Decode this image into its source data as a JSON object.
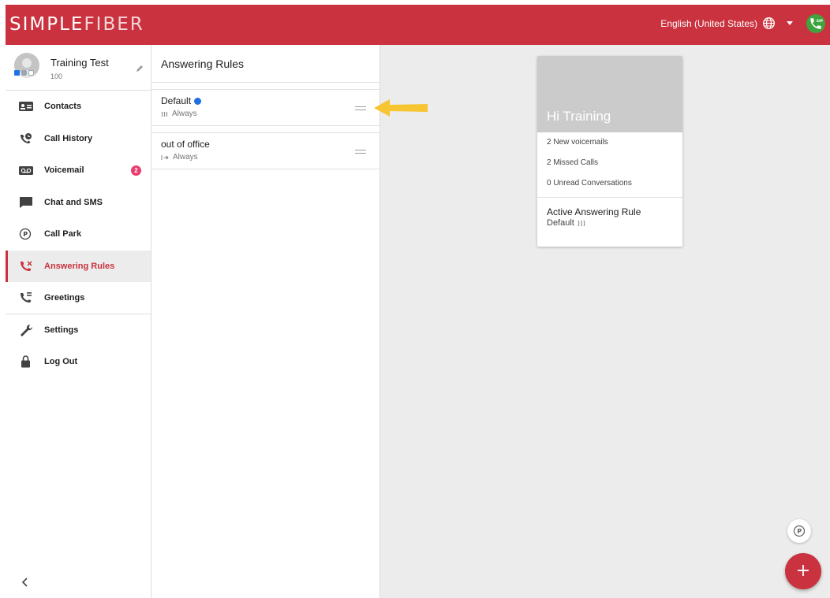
{
  "app": {
    "logo_part1": "SIMPLE",
    "logo_part2": "FIBER",
    "brand_color": "#c9323e"
  },
  "header": {
    "language": "English (United States)",
    "language_icon": "globe-icon",
    "sip_status_icon": "sip-phone-icon"
  },
  "profile": {
    "name": "Training Test",
    "extension": "100"
  },
  "sidebar": {
    "items": [
      {
        "label": "Contacts",
        "icon": "contacts-icon"
      },
      {
        "label": "Call History",
        "icon": "call-history-icon"
      },
      {
        "label": "Voicemail",
        "icon": "voicemail-icon",
        "badge": "2"
      },
      {
        "label": "Chat and SMS",
        "icon": "chat-icon"
      },
      {
        "label": "Call Park",
        "icon": "call-park-icon"
      },
      {
        "label": "Answering Rules",
        "icon": "answering-rules-icon",
        "active": true
      },
      {
        "label": "Greetings",
        "icon": "greetings-icon"
      },
      {
        "label": "Settings",
        "icon": "wrench-icon"
      },
      {
        "label": "Log Out",
        "icon": "lock-icon"
      }
    ]
  },
  "answering_rules": {
    "title": "Answering Rules",
    "rules": [
      {
        "name": "Default",
        "schedule": "Always",
        "active": true,
        "icon": "ring-all-icon"
      },
      {
        "name": "out of office",
        "schedule": "Always",
        "active": false,
        "icon": "forward-icon"
      }
    ]
  },
  "summary_card": {
    "greeting": "Hi Training",
    "stats": [
      "2 New voicemails",
      "2 Missed Calls",
      "0 Unread Conversations"
    ],
    "active_rule_label": "Active Answering Rule",
    "active_rule_value": "Default"
  },
  "fab": {
    "add_label": "+"
  }
}
